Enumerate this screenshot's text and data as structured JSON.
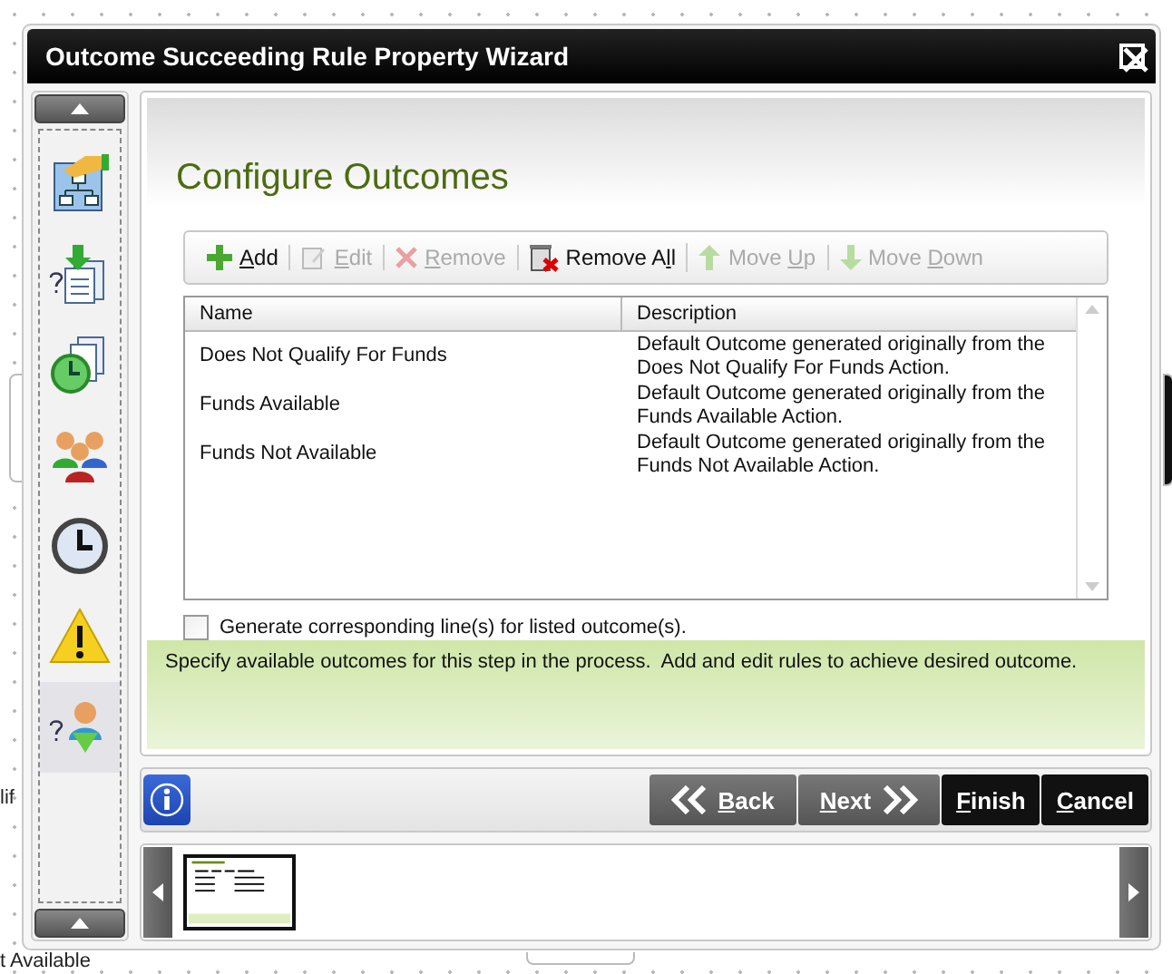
{
  "canvas": {
    "labels": [
      "lif",
      "t Available"
    ]
  },
  "window": {
    "title": "Outcome Succeeding Rule Property Wizard"
  },
  "steps": [
    {
      "kind": "flow",
      "selected": false
    },
    {
      "kind": "document",
      "selected": false
    },
    {
      "kind": "clock-documents",
      "selected": false
    },
    {
      "kind": "people",
      "selected": false
    },
    {
      "kind": "clock",
      "selected": false
    },
    {
      "kind": "warning",
      "selected": false
    },
    {
      "kind": "person",
      "selected": true
    }
  ],
  "page": {
    "title": "Configure Outcomes"
  },
  "toolbar": [
    {
      "kind": "add",
      "key": "A",
      "post": "dd",
      "disabled": false
    },
    {
      "kind": "edit",
      "key": "E",
      "post": "dit",
      "disabled": true
    },
    {
      "kind": "remove",
      "key": "R",
      "post": "emove",
      "disabled": true
    },
    {
      "kind": "remove-all",
      "pre": "Remove A",
      "key": "l",
      "post": "l",
      "disabled": false
    },
    {
      "kind": "up",
      "pre": "Move ",
      "key": "U",
      "post": "p",
      "disabled": true
    },
    {
      "kind": "down",
      "pre": "Move ",
      "key": "D",
      "post": "own",
      "disabled": true
    }
  ],
  "table": {
    "columns": [
      "Name",
      "Description"
    ],
    "rows": [
      {
        "name": "Does Not Qualify For Funds",
        "description": "Default Outcome generated originally from the Does Not Qualify For Funds Action."
      },
      {
        "name": "Funds Available",
        "description": "Default Outcome generated originally from the Funds Available Action."
      },
      {
        "name": "Funds Not Available",
        "description": "Default Outcome generated originally from the Funds Not Available Action."
      }
    ]
  },
  "generate_lines": {
    "label": "Generate corresponding line(s) for listed outcome(s).",
    "checked": false
  },
  "hint": "Specify available outcomes for this step in the process.  Add and edit rules to achieve desired outcome.",
  "nav_buttons": [
    {
      "kind": "back",
      "key": "B",
      "post": "ack"
    },
    {
      "kind": "next",
      "key": "N",
      "post": "ext"
    },
    {
      "kind": "finish",
      "key": "F",
      "post": "inish"
    },
    {
      "kind": "cancel",
      "key": "C",
      "post": "ancel"
    }
  ]
}
